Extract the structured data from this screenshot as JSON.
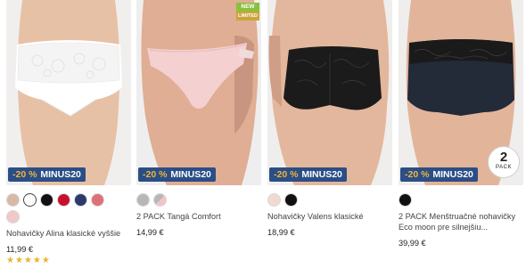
{
  "products": [
    {
      "name": "Nohavičky Alina klasické vyššie",
      "price": "11,99 €",
      "promo": "-20 % MINUS20",
      "rating_stars": 5,
      "colors": [
        "#d8b9a3",
        "#ffffff",
        "#111111",
        "#c8102e",
        "#2b3a6b",
        "#e0707a",
        "#f0c8c8"
      ],
      "stars_text": "★★★★★"
    },
    {
      "name": "2 PACK Tangá Comfort",
      "price": "14,99 €",
      "promo": "-20 % MINUS20",
      "badge": {
        "line1": "NEW",
        "line2": "LIMITED"
      },
      "colors": [
        "#b7b7b7",
        "split-grey-pink"
      ]
    },
    {
      "name": "Nohavičky Valens klasické",
      "price": "18,99 €",
      "promo": "-20 % MINUS20",
      "colors": [
        "#f2d9cf",
        "#111111"
      ]
    },
    {
      "name": "2 PACK Menštruačné nohavičky Eco moon pre silnejšiu...",
      "price": "39,99 €",
      "promo": "-20 % MINUS20",
      "pack": {
        "number": "2",
        "label": "PACK"
      },
      "colors": [
        "#111111"
      ]
    }
  ]
}
